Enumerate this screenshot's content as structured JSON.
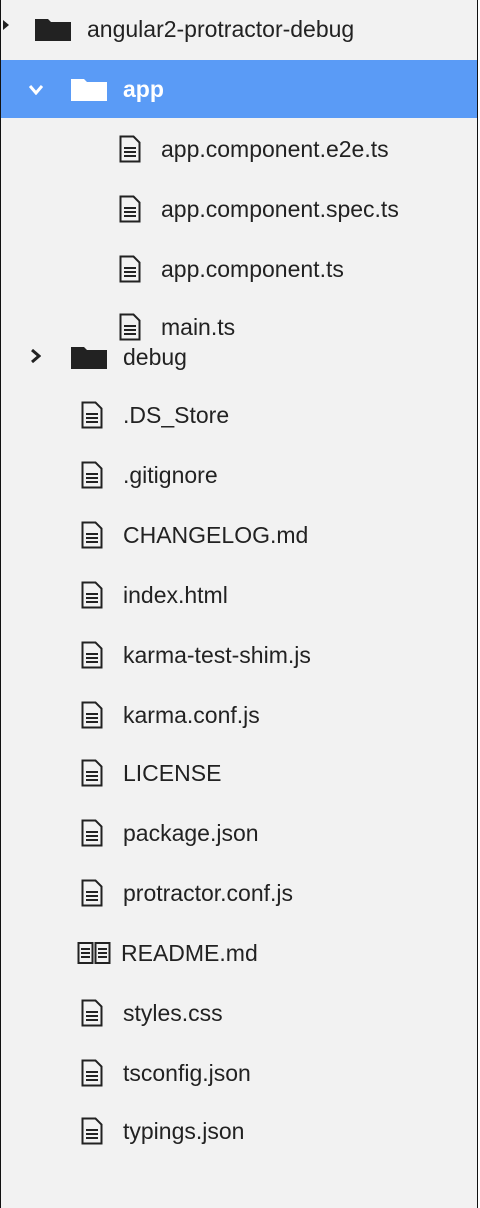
{
  "tree": {
    "root": {
      "name": "angular2-protractor-debug",
      "icon": "folder-icon"
    },
    "app_folder": {
      "name": "app",
      "icon": "folder-icon",
      "expanded": true,
      "selected": true,
      "children": [
        {
          "name": "app.component.e2e.ts",
          "icon": "file-icon"
        },
        {
          "name": "app.component.spec.ts",
          "icon": "file-icon"
        },
        {
          "name": "app.component.ts",
          "icon": "file-icon"
        },
        {
          "name": "main.ts",
          "icon": "file-icon"
        }
      ]
    },
    "debug_folder": {
      "name": "debug",
      "icon": "folder-icon",
      "expanded": false
    },
    "files": [
      {
        "name": ".DS_Store",
        "icon": "file-icon"
      },
      {
        "name": ".gitignore",
        "icon": "file-icon"
      },
      {
        "name": "CHANGELOG.md",
        "icon": "file-icon"
      },
      {
        "name": "index.html",
        "icon": "file-icon"
      },
      {
        "name": "karma-test-shim.js",
        "icon": "file-icon"
      },
      {
        "name": "karma.conf.js",
        "icon": "file-icon"
      },
      {
        "name": "LICENSE",
        "icon": "file-icon"
      },
      {
        "name": "package.json",
        "icon": "file-icon"
      },
      {
        "name": "protractor.conf.js",
        "icon": "file-icon"
      },
      {
        "name": "README.md",
        "icon": "book-icon"
      },
      {
        "name": "styles.css",
        "icon": "file-icon"
      },
      {
        "name": "tsconfig.json",
        "icon": "file-icon"
      },
      {
        "name": "typings.json",
        "icon": "file-icon"
      }
    ]
  },
  "colors": {
    "selection": "#5a9bf6",
    "panel_background": "#f2f2f2",
    "icon": "#222222"
  }
}
